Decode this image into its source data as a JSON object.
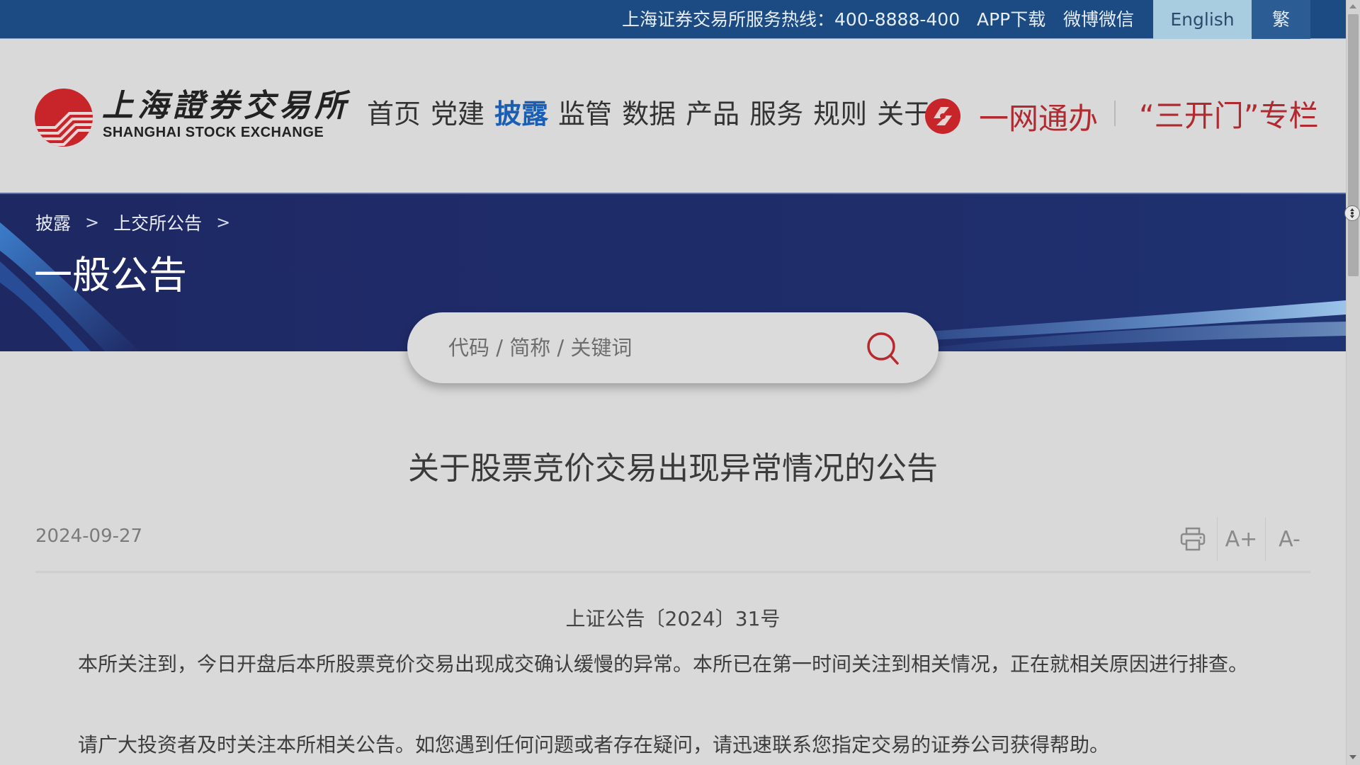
{
  "topbar": {
    "hotline": "上海证券交易所服务热线：400-8888-400",
    "app_download": "APP下载",
    "weibo_weixin": "微博微信",
    "lang_english": "English",
    "lang_traditional": "繁"
  },
  "header": {
    "logo_cn": "上海證券交易所",
    "logo_en": "SHANGHAI STOCK EXCHANGE",
    "nav": [
      {
        "label": "首页"
      },
      {
        "label": "党建"
      },
      {
        "label": "披露",
        "active": true
      },
      {
        "label": "监管"
      },
      {
        "label": "数据"
      },
      {
        "label": "产品"
      },
      {
        "label": "服务"
      },
      {
        "label": "规则"
      },
      {
        "label": "关于"
      }
    ],
    "yiwangtongban": "一网通办",
    "sankaimen": "“三开门”专栏"
  },
  "banner": {
    "breadcrumb": [
      "披露",
      "上交所公告"
    ],
    "breadcrumb_separator": ">",
    "title": "一般公告"
  },
  "search": {
    "placeholder": "代码 / 简称 / 关键词",
    "value": ""
  },
  "article": {
    "title": "关于股票竞价交易出现异常情况的公告",
    "date": "2024-09-27",
    "tools": {
      "print": "print-icon",
      "font_increase": "A+",
      "font_decrease": "A-"
    },
    "doc_number": "上证公告〔2024〕31号",
    "paragraphs": [
      "本所关注到，今日开盘后本所股票竞价交易出现成交确认缓慢的异常。本所已在第一时间关注到相关情况，正在就相关原因进行排查。",
      "请广大投资者及时关注本所相关公告。如您遇到任何问题或者存在疑问，请迅速联系您指定交易的证券公司获得帮助。"
    ]
  },
  "colors": {
    "topbar_bg": "#1b4b82",
    "nav_active": "#1a5fb4",
    "brand_red": "#b02a30",
    "banner_bg": "#1e2a66"
  }
}
